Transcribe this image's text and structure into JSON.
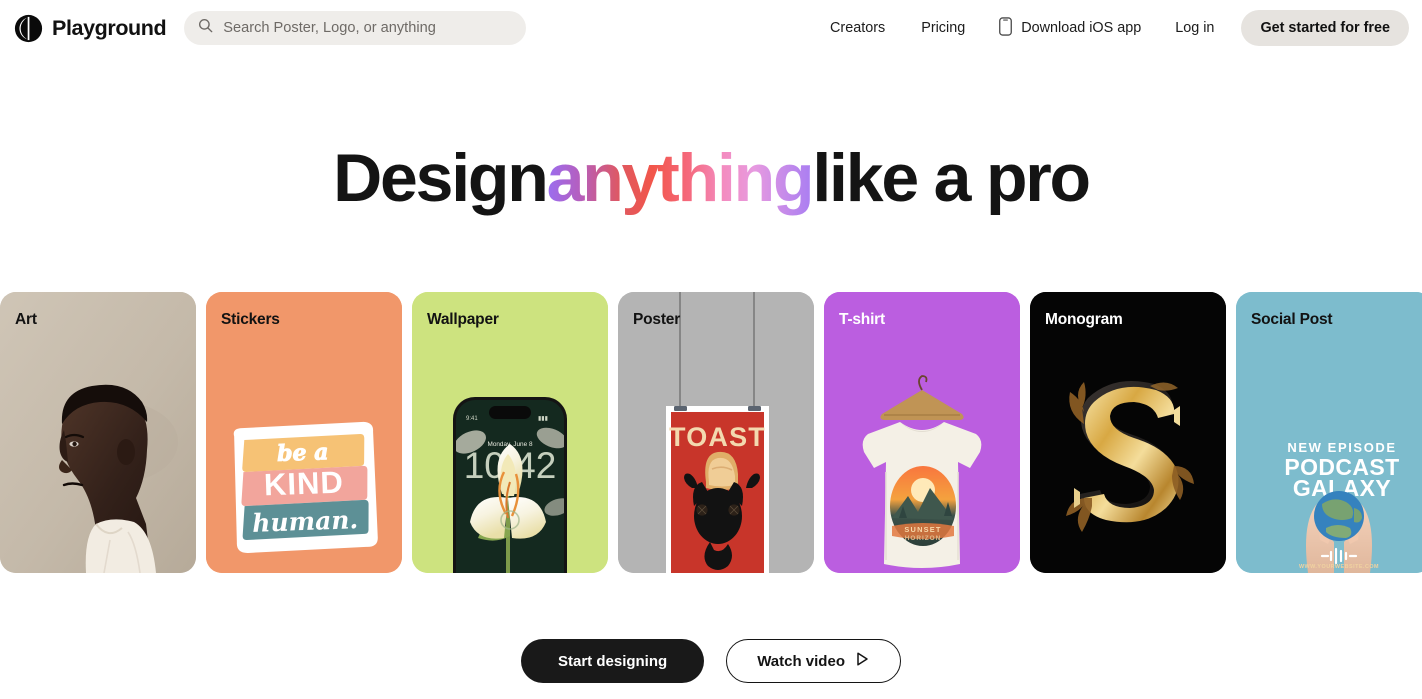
{
  "header": {
    "brand": {
      "name": "Playground",
      "logo_icon": "playground-logo-icon"
    },
    "search": {
      "icon": "search-icon",
      "placeholder": "Search Poster, Logo, or anything",
      "value": ""
    },
    "nav": [
      {
        "label": "Creators",
        "icon": null
      },
      {
        "label": "Pricing",
        "icon": null
      },
      {
        "label": "Download iOS app",
        "icon": "phone-icon"
      },
      {
        "label": "Log in",
        "icon": null
      }
    ],
    "cta": {
      "label": "Get started for free",
      "bg": "#e6e3df",
      "color": "#111111"
    }
  },
  "hero": {
    "headline_part1": "Design",
    "headline_highlight": "anything",
    "headline_part2": "like a pro",
    "highlight_gradient": [
      "#9b6ef0",
      "#e0585f",
      "#f2564a",
      "#f48bbe",
      "#a97ef2"
    ]
  },
  "cards": [
    {
      "label": "Art",
      "label_color": "#121212",
      "bg": "#c9bfb0",
      "art": "portrait-photo"
    },
    {
      "label": "Stickers",
      "label_color": "#121212",
      "bg": "#f1976a",
      "art": "be-a-kind-human-sticker",
      "art_text": [
        "be a",
        "KIND",
        "human."
      ]
    },
    {
      "label": "Wallpaper",
      "label_color": "#121212",
      "bg": "#cde37f",
      "art": "phone-lockscreen-tulip",
      "art_text": [
        "Monday, June 8",
        "10:42"
      ]
    },
    {
      "label": "Poster",
      "label_color": "#121212",
      "bg": "#b4b4b4",
      "art": "toast-cat-poster",
      "art_text": [
        "TOAST"
      ]
    },
    {
      "label": "T-shirt",
      "label_color": "#ffffff",
      "bg": "#bb5ee0",
      "art": "tshirt-on-hanger",
      "art_text": [
        "SUNSET",
        "HORIZON"
      ]
    },
    {
      "label": "Monogram",
      "label_color": "#ffffff",
      "bg": "#050505",
      "art": "gold-letter-s",
      "art_text": [
        "S"
      ]
    },
    {
      "label": "Social Post",
      "label_color": "#121212",
      "bg": "#7dbccd",
      "art": "podcast-galaxy-post",
      "art_text": [
        "NEW EPISODE",
        "PODCAST",
        "GALAXY",
        "WWW.YOURWEBSITE.COM"
      ]
    }
  ],
  "actions": {
    "primary": {
      "label": "Start designing"
    },
    "secondary": {
      "label": "Watch video",
      "icon": "play-icon"
    }
  }
}
